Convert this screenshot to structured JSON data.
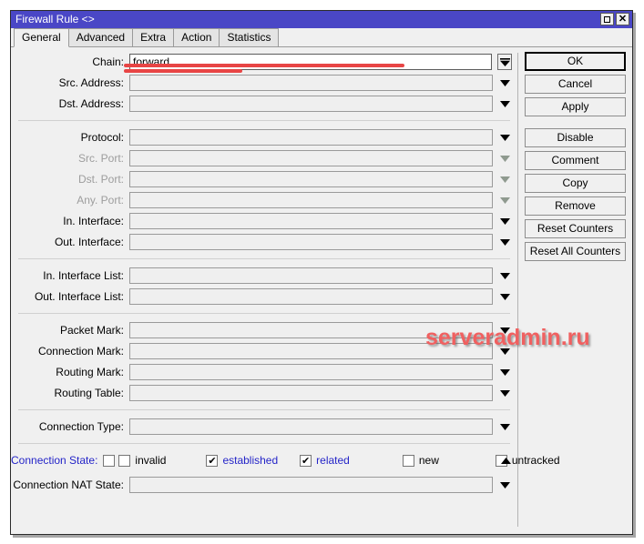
{
  "window": {
    "title": "Firewall Rule <>",
    "title_buttons": [
      {
        "name": "maximize-button",
        "glyph": "maximize-icon"
      },
      {
        "name": "close-button",
        "glyph": "close-icon"
      }
    ]
  },
  "tabs": [
    {
      "label": "General",
      "active": true
    },
    {
      "label": "Advanced",
      "active": false
    },
    {
      "label": "Extra",
      "active": false
    },
    {
      "label": "Action",
      "active": false
    },
    {
      "label": "Statistics",
      "active": false
    }
  ],
  "form": {
    "groups": [
      {
        "rows": [
          {
            "name": "chain",
            "label": "Chain:",
            "value": "forward",
            "state": "active",
            "control": "combo-button"
          },
          {
            "name": "src-address",
            "label": "Src. Address:",
            "value": "",
            "state": "normal",
            "control": "arrow"
          },
          {
            "name": "dst-address",
            "label": "Dst. Address:",
            "value": "",
            "state": "normal",
            "control": "arrow"
          }
        ]
      },
      {
        "rows": [
          {
            "name": "protocol",
            "label": "Protocol:",
            "value": "",
            "state": "normal",
            "control": "arrow"
          },
          {
            "name": "src-port",
            "label": "Src. Port:",
            "value": "",
            "state": "disabled",
            "control": "arrow"
          },
          {
            "name": "dst-port",
            "label": "Dst. Port:",
            "value": "",
            "state": "disabled",
            "control": "arrow"
          },
          {
            "name": "any-port",
            "label": "Any. Port:",
            "value": "",
            "state": "disabled",
            "control": "arrow"
          },
          {
            "name": "in-interface",
            "label": "In. Interface:",
            "value": "",
            "state": "normal",
            "control": "arrow"
          },
          {
            "name": "out-interface",
            "label": "Out. Interface:",
            "value": "",
            "state": "normal",
            "control": "arrow"
          }
        ]
      },
      {
        "rows": [
          {
            "name": "in-interface-list",
            "label": "In. Interface List:",
            "value": "",
            "state": "normal",
            "control": "arrow"
          },
          {
            "name": "out-interface-list",
            "label": "Out. Interface List:",
            "value": "",
            "state": "normal",
            "control": "arrow"
          }
        ]
      },
      {
        "rows": [
          {
            "name": "packet-mark",
            "label": "Packet Mark:",
            "value": "",
            "state": "normal",
            "control": "arrow"
          },
          {
            "name": "connection-mark",
            "label": "Connection Mark:",
            "value": "",
            "state": "normal",
            "control": "arrow"
          },
          {
            "name": "routing-mark",
            "label": "Routing Mark:",
            "value": "",
            "state": "normal",
            "control": "arrow"
          },
          {
            "name": "routing-table",
            "label": "Routing Table:",
            "value": "",
            "state": "normal",
            "control": "arrow"
          }
        ]
      },
      {
        "rows": [
          {
            "name": "connection-type",
            "label": "Connection Type:",
            "value": "",
            "state": "normal",
            "control": "arrow"
          }
        ]
      }
    ],
    "connection_state": {
      "label": "Connection State:",
      "label_style": "link",
      "negate_checked": false,
      "options": [
        {
          "name": "invalid",
          "label": "invalid",
          "checked": false,
          "highlight": false
        },
        {
          "name": "established",
          "label": "established",
          "checked": true,
          "highlight": true
        },
        {
          "name": "related",
          "label": "related",
          "checked": true,
          "highlight": true
        },
        {
          "name": "new",
          "label": "new",
          "checked": false,
          "highlight": false
        },
        {
          "name": "untracked",
          "label": "untracked",
          "checked": false,
          "highlight": false
        }
      ]
    },
    "connection_nat_state": {
      "label": "Connection NAT State:",
      "value": ""
    }
  },
  "buttons": [
    {
      "name": "ok-button",
      "label": "OK",
      "primary": true,
      "gap": false
    },
    {
      "name": "cancel-button",
      "label": "Cancel",
      "primary": false,
      "gap": false
    },
    {
      "name": "apply-button",
      "label": "Apply",
      "primary": false,
      "gap": false
    },
    {
      "name": "disable-button",
      "label": "Disable",
      "primary": false,
      "gap": true
    },
    {
      "name": "comment-button",
      "label": "Comment",
      "primary": false,
      "gap": false
    },
    {
      "name": "copy-button",
      "label": "Copy",
      "primary": false,
      "gap": false
    },
    {
      "name": "remove-button",
      "label": "Remove",
      "primary": false,
      "gap": false
    },
    {
      "name": "reset-counters-button",
      "label": "Reset Counters",
      "primary": false,
      "gap": false
    },
    {
      "name": "reset-all-counters-button",
      "label": "Reset All Counters",
      "primary": false,
      "gap": false
    }
  ],
  "annotations": {
    "watermark": "serveradmin.ru",
    "accent_color": "#e84545",
    "title_color": "#4a47c6",
    "link_color": "#2424c8"
  }
}
